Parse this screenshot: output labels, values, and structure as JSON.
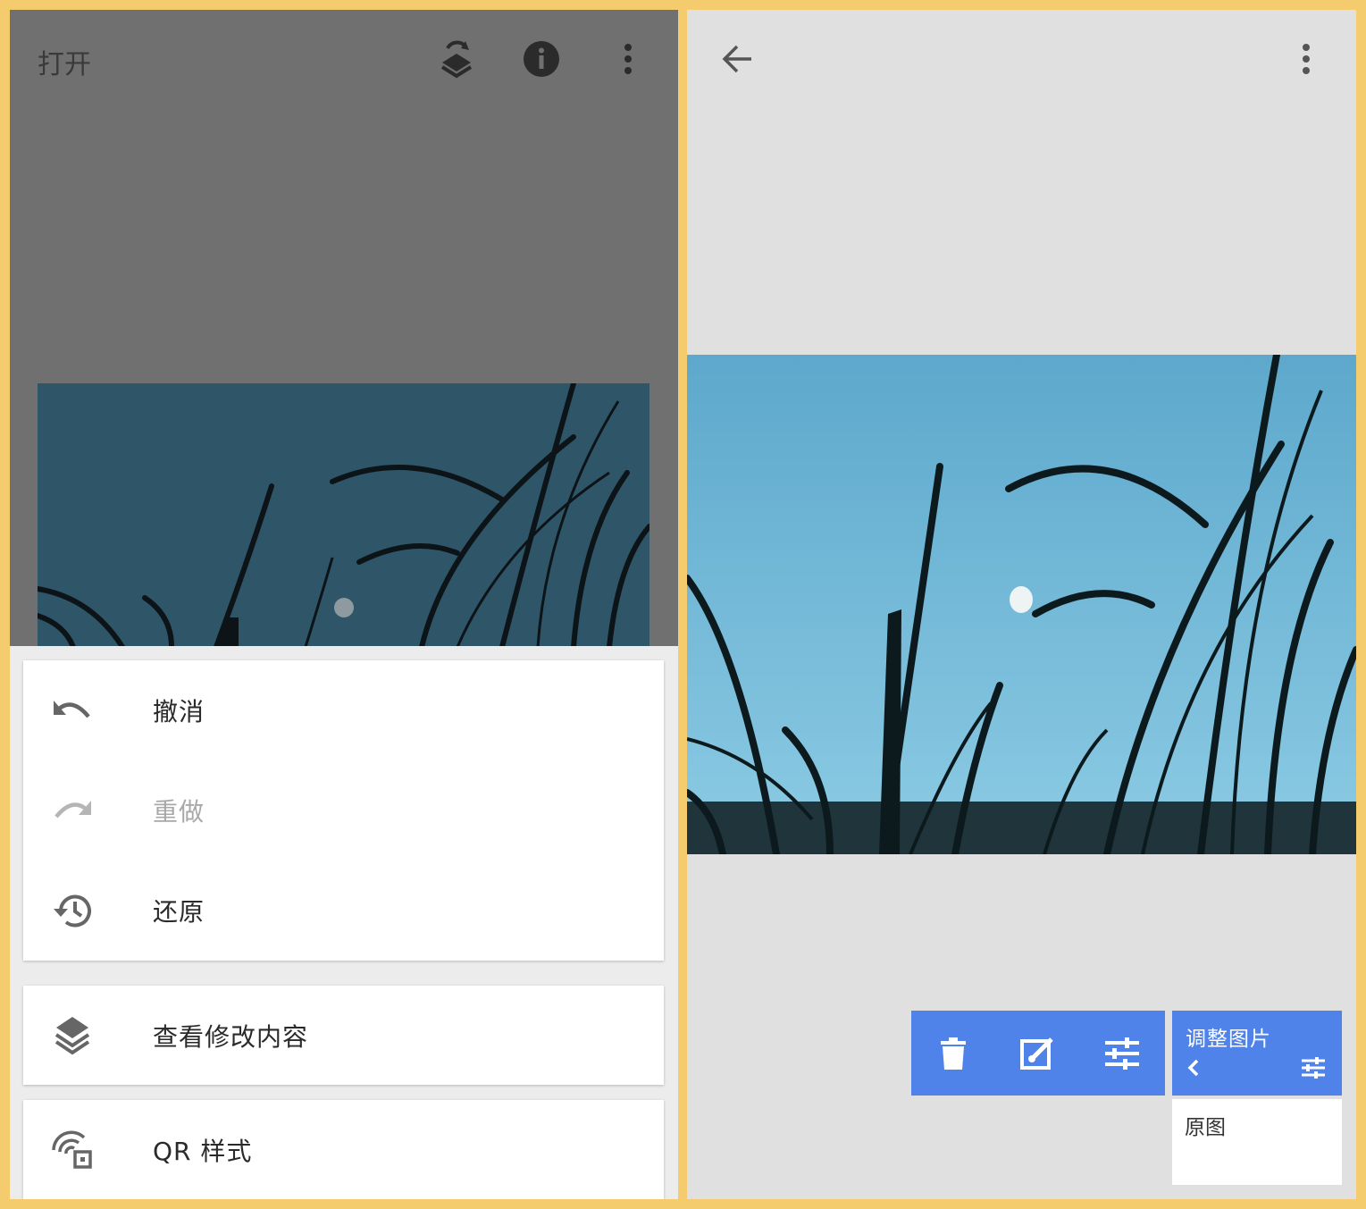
{
  "left_screen": {
    "topbar": {
      "title": "打开",
      "icons": [
        "layers-rotate-icon",
        "info-icon",
        "more-vert-icon"
      ]
    },
    "menu": {
      "items": [
        {
          "label": "撤消",
          "icon": "undo-icon",
          "enabled": true
        },
        {
          "label": "重做",
          "icon": "redo-icon",
          "enabled": false
        },
        {
          "label": "还原",
          "icon": "history-icon",
          "enabled": true
        }
      ],
      "view_edits": {
        "label": "查看修改内容",
        "icon": "layers-icon"
      },
      "qr_style": {
        "label": "QR 样式",
        "icon": "qr-style-icon"
      }
    }
  },
  "right_screen": {
    "topbar": {
      "icons": [
        "back-arrow-icon",
        "more-vert-icon"
      ]
    },
    "tools_bar": {
      "icons": [
        "delete-icon",
        "edit-brush-icon",
        "sliders-icon"
      ]
    },
    "adjust_card": {
      "title": "调整图片",
      "icons": [
        "chevron-left-icon",
        "sliders-icon"
      ]
    },
    "original": {
      "label": "原图"
    }
  },
  "colors": {
    "frame": "#f4cc6e",
    "scrim": "#707070",
    "accent": "#4f83ea",
    "sheet": "#ececec",
    "right_bg": "#e0e0e0"
  }
}
